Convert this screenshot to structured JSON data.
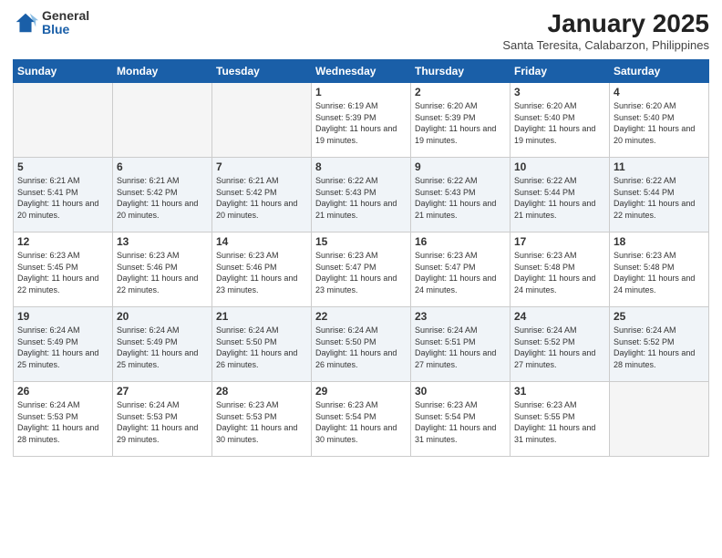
{
  "logo": {
    "general": "General",
    "blue": "Blue"
  },
  "header": {
    "title": "January 2025",
    "subtitle": "Santa Teresita, Calabarzon, Philippines"
  },
  "days_of_week": [
    "Sunday",
    "Monday",
    "Tuesday",
    "Wednesday",
    "Thursday",
    "Friday",
    "Saturday"
  ],
  "weeks": [
    [
      {
        "day": "",
        "sunrise": "",
        "sunset": "",
        "daylight": "",
        "empty": true
      },
      {
        "day": "",
        "sunrise": "",
        "sunset": "",
        "daylight": "",
        "empty": true
      },
      {
        "day": "",
        "sunrise": "",
        "sunset": "",
        "daylight": "",
        "empty": true
      },
      {
        "day": "1",
        "sunrise": "Sunrise: 6:19 AM",
        "sunset": "Sunset: 5:39 PM",
        "daylight": "Daylight: 11 hours and 19 minutes."
      },
      {
        "day": "2",
        "sunrise": "Sunrise: 6:20 AM",
        "sunset": "Sunset: 5:39 PM",
        "daylight": "Daylight: 11 hours and 19 minutes."
      },
      {
        "day": "3",
        "sunrise": "Sunrise: 6:20 AM",
        "sunset": "Sunset: 5:40 PM",
        "daylight": "Daylight: 11 hours and 19 minutes."
      },
      {
        "day": "4",
        "sunrise": "Sunrise: 6:20 AM",
        "sunset": "Sunset: 5:40 PM",
        "daylight": "Daylight: 11 hours and 20 minutes."
      }
    ],
    [
      {
        "day": "5",
        "sunrise": "Sunrise: 6:21 AM",
        "sunset": "Sunset: 5:41 PM",
        "daylight": "Daylight: 11 hours and 20 minutes."
      },
      {
        "day": "6",
        "sunrise": "Sunrise: 6:21 AM",
        "sunset": "Sunset: 5:42 PM",
        "daylight": "Daylight: 11 hours and 20 minutes."
      },
      {
        "day": "7",
        "sunrise": "Sunrise: 6:21 AM",
        "sunset": "Sunset: 5:42 PM",
        "daylight": "Daylight: 11 hours and 20 minutes."
      },
      {
        "day": "8",
        "sunrise": "Sunrise: 6:22 AM",
        "sunset": "Sunset: 5:43 PM",
        "daylight": "Daylight: 11 hours and 21 minutes."
      },
      {
        "day": "9",
        "sunrise": "Sunrise: 6:22 AM",
        "sunset": "Sunset: 5:43 PM",
        "daylight": "Daylight: 11 hours and 21 minutes."
      },
      {
        "day": "10",
        "sunrise": "Sunrise: 6:22 AM",
        "sunset": "Sunset: 5:44 PM",
        "daylight": "Daylight: 11 hours and 21 minutes."
      },
      {
        "day": "11",
        "sunrise": "Sunrise: 6:22 AM",
        "sunset": "Sunset: 5:44 PM",
        "daylight": "Daylight: 11 hours and 22 minutes."
      }
    ],
    [
      {
        "day": "12",
        "sunrise": "Sunrise: 6:23 AM",
        "sunset": "Sunset: 5:45 PM",
        "daylight": "Daylight: 11 hours and 22 minutes."
      },
      {
        "day": "13",
        "sunrise": "Sunrise: 6:23 AM",
        "sunset": "Sunset: 5:46 PM",
        "daylight": "Daylight: 11 hours and 22 minutes."
      },
      {
        "day": "14",
        "sunrise": "Sunrise: 6:23 AM",
        "sunset": "Sunset: 5:46 PM",
        "daylight": "Daylight: 11 hours and 23 minutes."
      },
      {
        "day": "15",
        "sunrise": "Sunrise: 6:23 AM",
        "sunset": "Sunset: 5:47 PM",
        "daylight": "Daylight: 11 hours and 23 minutes."
      },
      {
        "day": "16",
        "sunrise": "Sunrise: 6:23 AM",
        "sunset": "Sunset: 5:47 PM",
        "daylight": "Daylight: 11 hours and 24 minutes."
      },
      {
        "day": "17",
        "sunrise": "Sunrise: 6:23 AM",
        "sunset": "Sunset: 5:48 PM",
        "daylight": "Daylight: 11 hours and 24 minutes."
      },
      {
        "day": "18",
        "sunrise": "Sunrise: 6:23 AM",
        "sunset": "Sunset: 5:48 PM",
        "daylight": "Daylight: 11 hours and 24 minutes."
      }
    ],
    [
      {
        "day": "19",
        "sunrise": "Sunrise: 6:24 AM",
        "sunset": "Sunset: 5:49 PM",
        "daylight": "Daylight: 11 hours and 25 minutes."
      },
      {
        "day": "20",
        "sunrise": "Sunrise: 6:24 AM",
        "sunset": "Sunset: 5:49 PM",
        "daylight": "Daylight: 11 hours and 25 minutes."
      },
      {
        "day": "21",
        "sunrise": "Sunrise: 6:24 AM",
        "sunset": "Sunset: 5:50 PM",
        "daylight": "Daylight: 11 hours and 26 minutes."
      },
      {
        "day": "22",
        "sunrise": "Sunrise: 6:24 AM",
        "sunset": "Sunset: 5:50 PM",
        "daylight": "Daylight: 11 hours and 26 minutes."
      },
      {
        "day": "23",
        "sunrise": "Sunrise: 6:24 AM",
        "sunset": "Sunset: 5:51 PM",
        "daylight": "Daylight: 11 hours and 27 minutes."
      },
      {
        "day": "24",
        "sunrise": "Sunrise: 6:24 AM",
        "sunset": "Sunset: 5:52 PM",
        "daylight": "Daylight: 11 hours and 27 minutes."
      },
      {
        "day": "25",
        "sunrise": "Sunrise: 6:24 AM",
        "sunset": "Sunset: 5:52 PM",
        "daylight": "Daylight: 11 hours and 28 minutes."
      }
    ],
    [
      {
        "day": "26",
        "sunrise": "Sunrise: 6:24 AM",
        "sunset": "Sunset: 5:53 PM",
        "daylight": "Daylight: 11 hours and 28 minutes."
      },
      {
        "day": "27",
        "sunrise": "Sunrise: 6:24 AM",
        "sunset": "Sunset: 5:53 PM",
        "daylight": "Daylight: 11 hours and 29 minutes."
      },
      {
        "day": "28",
        "sunrise": "Sunrise: 6:23 AM",
        "sunset": "Sunset: 5:53 PM",
        "daylight": "Daylight: 11 hours and 30 minutes."
      },
      {
        "day": "29",
        "sunrise": "Sunrise: 6:23 AM",
        "sunset": "Sunset: 5:54 PM",
        "daylight": "Daylight: 11 hours and 30 minutes."
      },
      {
        "day": "30",
        "sunrise": "Sunrise: 6:23 AM",
        "sunset": "Sunset: 5:54 PM",
        "daylight": "Daylight: 11 hours and 31 minutes."
      },
      {
        "day": "31",
        "sunrise": "Sunrise: 6:23 AM",
        "sunset": "Sunset: 5:55 PM",
        "daylight": "Daylight: 11 hours and 31 minutes."
      },
      {
        "day": "",
        "sunrise": "",
        "sunset": "",
        "daylight": "",
        "empty": true
      }
    ]
  ]
}
